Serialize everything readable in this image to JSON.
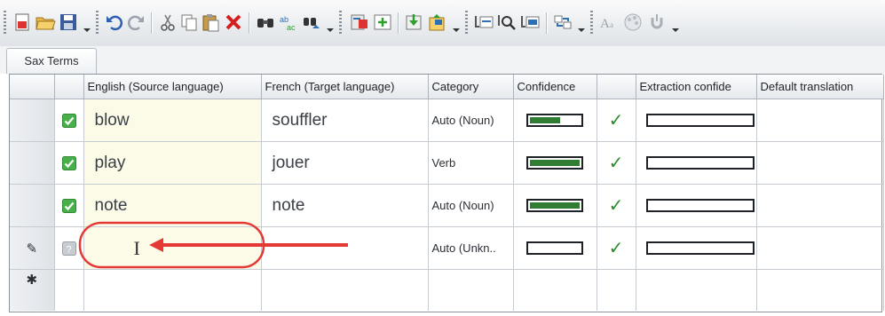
{
  "toolbar": {
    "buttons": [
      "new-document-icon",
      "open-folder-icon",
      "save-icon",
      "undo-icon",
      "redo-icon",
      "cut-icon",
      "copy-icon",
      "paste-icon",
      "delete-icon",
      "find-icon",
      "replace-icon",
      "find-next-icon",
      "term-properties-icon",
      "add-term-icon",
      "import-icon",
      "export-icon",
      "extract-terms-icon",
      "search-terms-icon",
      "term-list-icon",
      "refresh-icon",
      "font-icon",
      "palette-icon",
      "settings-icon"
    ]
  },
  "tab": {
    "label": "Sax Terms"
  },
  "grid": {
    "columns": {
      "source": "English (Source language)",
      "target": "French (Target language)",
      "category": "Category",
      "confidence": "Confidence",
      "extraction": "Extraction confide",
      "default": "Default translation"
    },
    "rows": [
      {
        "checked": true,
        "source": "blow",
        "target": "souffler",
        "category": "Auto (Noun)",
        "confidence": 0.6,
        "validated": true
      },
      {
        "checked": true,
        "source": "play",
        "target": "jouer",
        "category": "Verb",
        "confidence": 1.0,
        "validated": true
      },
      {
        "checked": true,
        "source": "note",
        "target": "note",
        "category": "Auto (Noun)",
        "confidence": 1.0,
        "validated": true
      },
      {
        "checked": null,
        "source": "",
        "target": "",
        "category": "Auto  (Unkn..",
        "confidence": 0.0,
        "validated": true,
        "editing": true
      }
    ],
    "new_row_marker": "✱",
    "edit_marker": "✎",
    "cursor_glyph": "I"
  },
  "colors": {
    "source_bg": "#fbfbe8",
    "confidence_fill": "#2e7d32",
    "check_green": "#2e8b2e",
    "annotation_red": "#e53935"
  }
}
